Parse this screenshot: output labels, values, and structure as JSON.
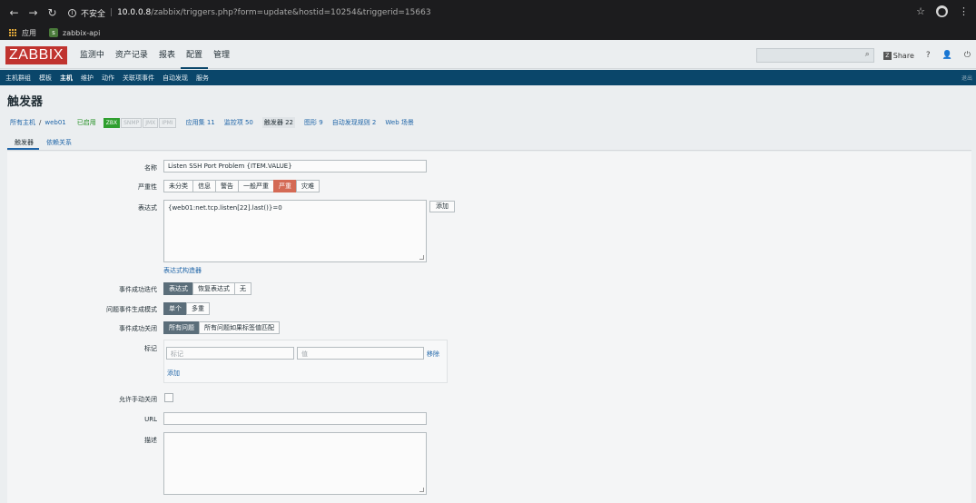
{
  "browser": {
    "security_label": "不安全",
    "url_host": "10.0.0.8",
    "url_path": "/zabbix/triggers.php?form=update&hostid=10254&triggerid=15663",
    "bookmarks": [
      {
        "label": "应用"
      },
      {
        "label": "zabbix-api"
      }
    ]
  },
  "header": {
    "logo": "ZABBIX",
    "menu": [
      "监测中",
      "资产记录",
      "报表",
      "配置",
      "管理"
    ],
    "active_menu": "配置",
    "share_label": "Share",
    "help": "?",
    "search_placeholder": ""
  },
  "submenu": {
    "items": [
      "主机群组",
      "模板",
      "主机",
      "维护",
      "动作",
      "关联项事件",
      "自动发现",
      "服务"
    ],
    "active": "主机",
    "logout": "退出"
  },
  "page": {
    "title": "触发器"
  },
  "breadcrumb": {
    "all_hosts": "所有主机",
    "separator": "/",
    "host": "web01",
    "status": "已启用",
    "badges": [
      "ZBX",
      "SNMP",
      "JMX",
      "IPMI"
    ],
    "links": [
      "应用集 11",
      "监控项 50",
      "触发器 22",
      "图形 9",
      "自动发现规则 2",
      "Web 场景"
    ],
    "current_link": "触发器 22"
  },
  "tabs": [
    "触发器",
    "依赖关系"
  ],
  "form": {
    "name_label": "名称",
    "name_value": "Listen SSH Port Problem {ITEM.VALUE}",
    "severity_label": "严重性",
    "severity_options": [
      "未分类",
      "信息",
      "警告",
      "一般严重",
      "严重",
      "灾难"
    ],
    "severity_selected": "严重",
    "expression_label": "表达式",
    "expression_value": "{web01:net.tcp.listen[22].last()}=0",
    "add_button": "添加",
    "expression_builder": "表达式构造器",
    "ok_event_label": "事件成功迭代",
    "ok_event_options": [
      "表达式",
      "恢复表达式",
      "无"
    ],
    "problem_mode_label": "问题事件生成模式",
    "problem_mode_options": [
      "单个",
      "多重"
    ],
    "ok_close_label": "事件成功关闭",
    "ok_close_options": [
      "所有问题",
      "所有问题如果标签值匹配"
    ],
    "tags_label": "标记",
    "tag_placeholder": "标记",
    "value_placeholder": "值",
    "remove_link": "移除",
    "add_tag_link": "添加",
    "manual_close_label": "允许手动关闭",
    "url_label": "URL",
    "url_value": "",
    "description_label": "描述",
    "description_value": ""
  },
  "colors": {
    "brand": "#c0332f",
    "nav_bar": "#0a466a",
    "selected_red": "#d46a55",
    "selected_grey": "#5b6e7a",
    "link": "#1f65a8"
  }
}
